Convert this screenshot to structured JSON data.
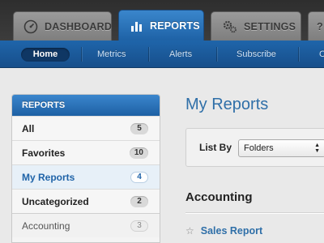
{
  "tabs": {
    "dashboard": "DASHBOARD",
    "reports": "REPORTS",
    "settings": "SETTINGS",
    "help": "?"
  },
  "subnav": {
    "home": "Home",
    "metrics": "Metrics",
    "alerts": "Alerts",
    "subscribe": "Subscribe",
    "cut_off": "C"
  },
  "sidebar": {
    "header": "REPORTS",
    "items": [
      {
        "label": "All",
        "count": "5"
      },
      {
        "label": "Favorites",
        "count": "10"
      },
      {
        "label": "My Reports",
        "count": "4"
      },
      {
        "label": "Uncategorized",
        "count": "2"
      }
    ],
    "sub_items": [
      {
        "label": "Accounting",
        "count": "3"
      }
    ]
  },
  "main": {
    "title": "My Reports",
    "list_by_label": "List By",
    "list_by_value": "Folders",
    "section_title": "Accounting",
    "reports": [
      {
        "name": "Sales Report"
      }
    ]
  },
  "colors": {
    "accent": "#1f63a8",
    "title": "#2f6fa8"
  }
}
